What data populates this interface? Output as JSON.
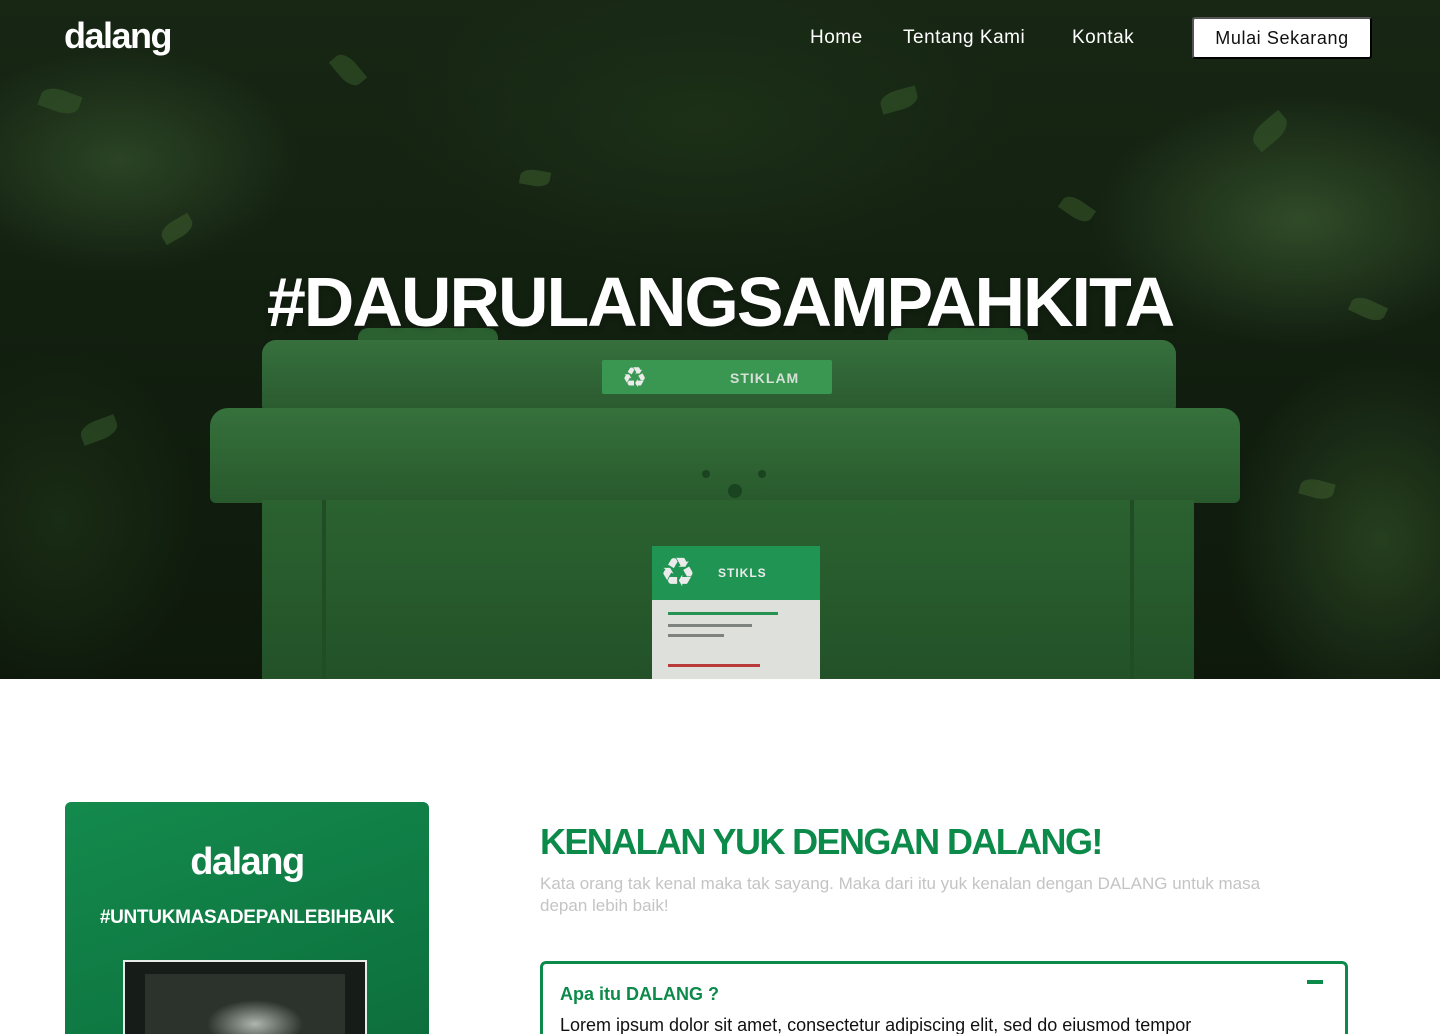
{
  "nav": {
    "logo": "dalang",
    "links": [
      "Home",
      "Tentang Kami",
      "Kontak"
    ],
    "cta": "Mulai Sekarang"
  },
  "hero": {
    "title": "#DAURULANGSAMPAHKITA",
    "bin_lid_label": "STIKLAM",
    "bin_sticker_label": "STIKLS"
  },
  "about": {
    "card": {
      "logo": "dalang",
      "tagline": "#UNTUKMASADEPANLEBIHBAIK"
    },
    "heading": "KENALAN YUK DENGAN DALANG!",
    "subtitle": "Kata orang tak kenal maka tak sayang. Maka dari itu yuk kenalan dengan DALANG untuk masa depan lebih baik!",
    "faq": [
      {
        "question": "Apa itu DALANG ?",
        "answer": "Lorem ipsum dolor sit amet, consectetur adipiscing elit, sed do eiusmod tempor",
        "expanded": true
      }
    ]
  },
  "colors": {
    "brand_green": "#0c8a4a",
    "white": "#ffffff"
  },
  "icons": {
    "recycle": "recycle-icon",
    "collapse": "minus-icon"
  }
}
